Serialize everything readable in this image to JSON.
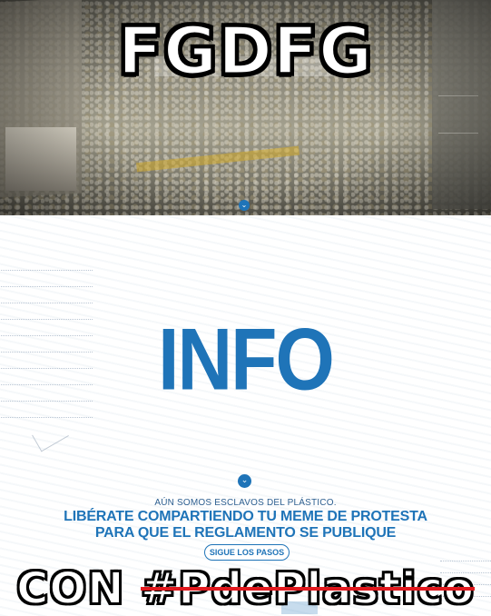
{
  "meme": {
    "top_text": "FGDFG",
    "bottom_prefix": "CON",
    "bottom_hashtag": "#PdePlastico"
  },
  "page": {
    "heading": "INFO",
    "line1": "AÚN SOMOS ESCLAVOS DEL PLÁSTICO.",
    "line2": "LIBÉRATE COMPARTIENDO TU MEME DE PROTESTA",
    "line3": "PARA QUE EL REGLAMENTO SE PUBLIQUE",
    "button_label": "SIGUE LOS PASOS"
  },
  "icons": {
    "hero_scroll": "chevron-down-icon",
    "page_scroll": "chevron-down-icon"
  },
  "colors": {
    "brand_blue": "#1f74b8",
    "strike_red": "#e1191e"
  }
}
